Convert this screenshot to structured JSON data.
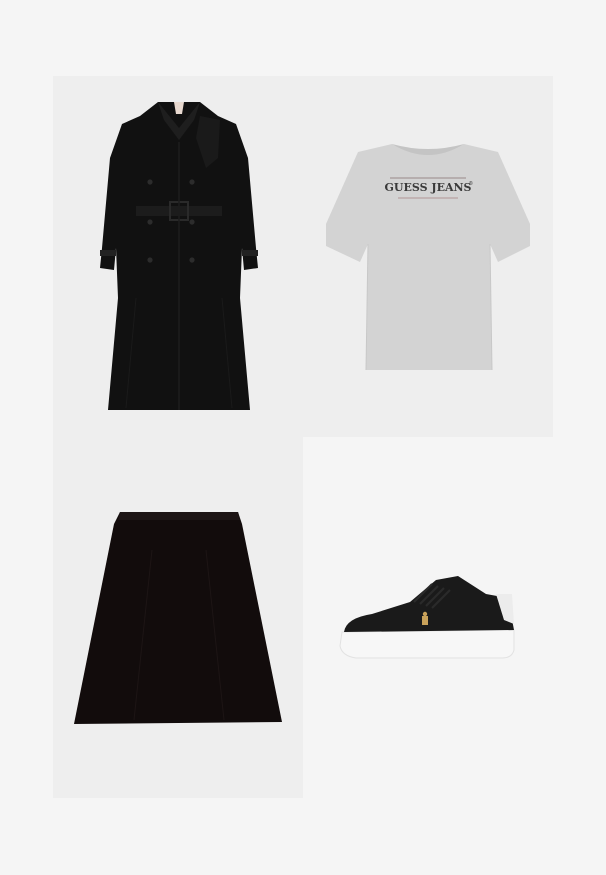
{
  "outfit": {
    "items": [
      {
        "id": "coat",
        "icon": "trench-coat-icon"
      },
      {
        "id": "tee",
        "icon": "t-shirt-icon",
        "print_text": "GUESS JEANS",
        "print_mark": "®"
      },
      {
        "id": "skirt",
        "icon": "a-line-skirt-icon"
      },
      {
        "id": "shoe",
        "icon": "sneaker-icon"
      }
    ]
  },
  "colors": {
    "page_background": "#f5f5f5",
    "panel_background": "#eeeeee",
    "coat": "#111111",
    "tee": "#d3d3d3",
    "skirt": "#120c0c",
    "shoe_upper": "#1a1a1a",
    "shoe_sole": "#f7f7f7"
  }
}
